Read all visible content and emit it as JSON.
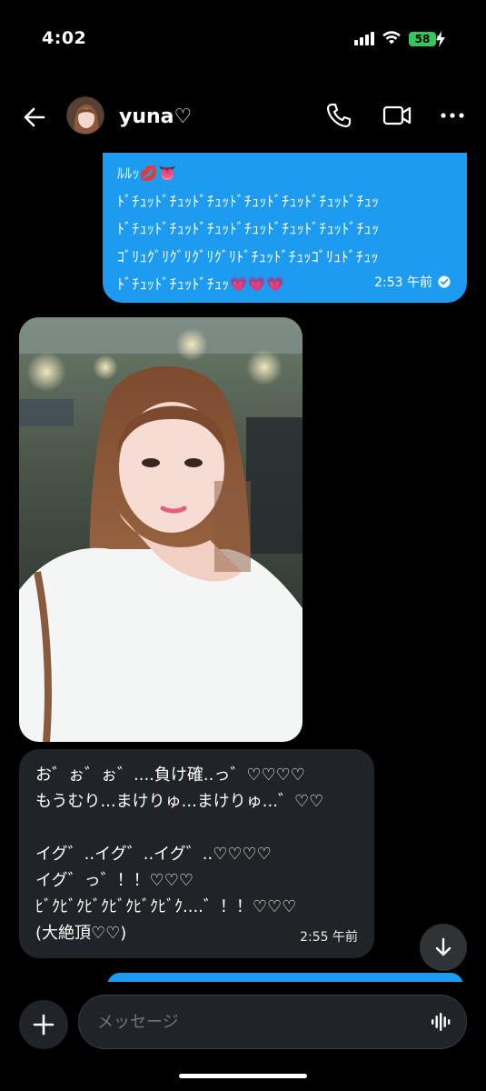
{
  "status_bar": {
    "time": "4:02",
    "battery": "58",
    "icons": [
      "signal-icon",
      "wifi-icon",
      "battery-icon",
      "charging-bolt-icon"
    ]
  },
  "header": {
    "contact_name": "yuna♡",
    "icons": [
      "back-arrow-icon",
      "avatar",
      "phone-icon",
      "video-camera-icon",
      "more-dots-icon"
    ]
  },
  "messages": [
    {
      "direction": "sent",
      "lines": [
        "ﾙﾙｯ💋👅",
        "ﾄﾞﾁｭｯﾄﾞﾁｭｯﾄﾞﾁｭｯﾄﾞﾁｭｯﾄﾞﾁｭｯﾄﾞﾁｭｯﾄﾞﾁｭｯ",
        "ﾄﾞﾁｭｯﾄﾞﾁｭｯﾄﾞﾁｭｯﾄﾞﾁｭｯﾄﾞﾁｭｯﾄﾞﾁｭｯﾄﾞﾁｭｯ",
        "ｺﾞﾘｭｸﾞﾘｸﾞﾘｸﾞﾘｸﾞﾘﾄﾞﾁｭｯﾄﾞﾁｭｯｺﾞﾘｭﾄﾞﾁｭｯ",
        "ﾄﾞﾁｭｯﾄﾞﾁｭｯﾄﾞﾁｭｯ💗💗💗"
      ],
      "time": "2:53 午前",
      "status_icon": "read-check-icon"
    },
    {
      "direction": "received",
      "type": "image",
      "image_description_icon": "photo-attachment"
    },
    {
      "direction": "received",
      "lines": [
        "お゛ぉ゛ぉ゛....負け確..っ゛♡♡♡♡",
        "もうむり...まけりゅ...まけりゅ...゛♡♡",
        "",
        "イグ゛..イグ゛..イグ゛..♡♡♡♡",
        "イグ゛っ゛！！♡♡♡",
        "ﾋﾞｸﾋﾞｸﾋﾞｸﾋﾞｸﾋﾞｸﾋﾞｸ....゛！！♡♡♡",
        "(大絶頂♡♡)"
      ],
      "time": "2:55 午前"
    }
  ],
  "composer": {
    "placeholder": "メッセージ",
    "value": ""
  },
  "colors": {
    "accent": "#1d9bf0",
    "received_bubble": "#202327",
    "background": "#000000",
    "battery": "#34c759"
  }
}
